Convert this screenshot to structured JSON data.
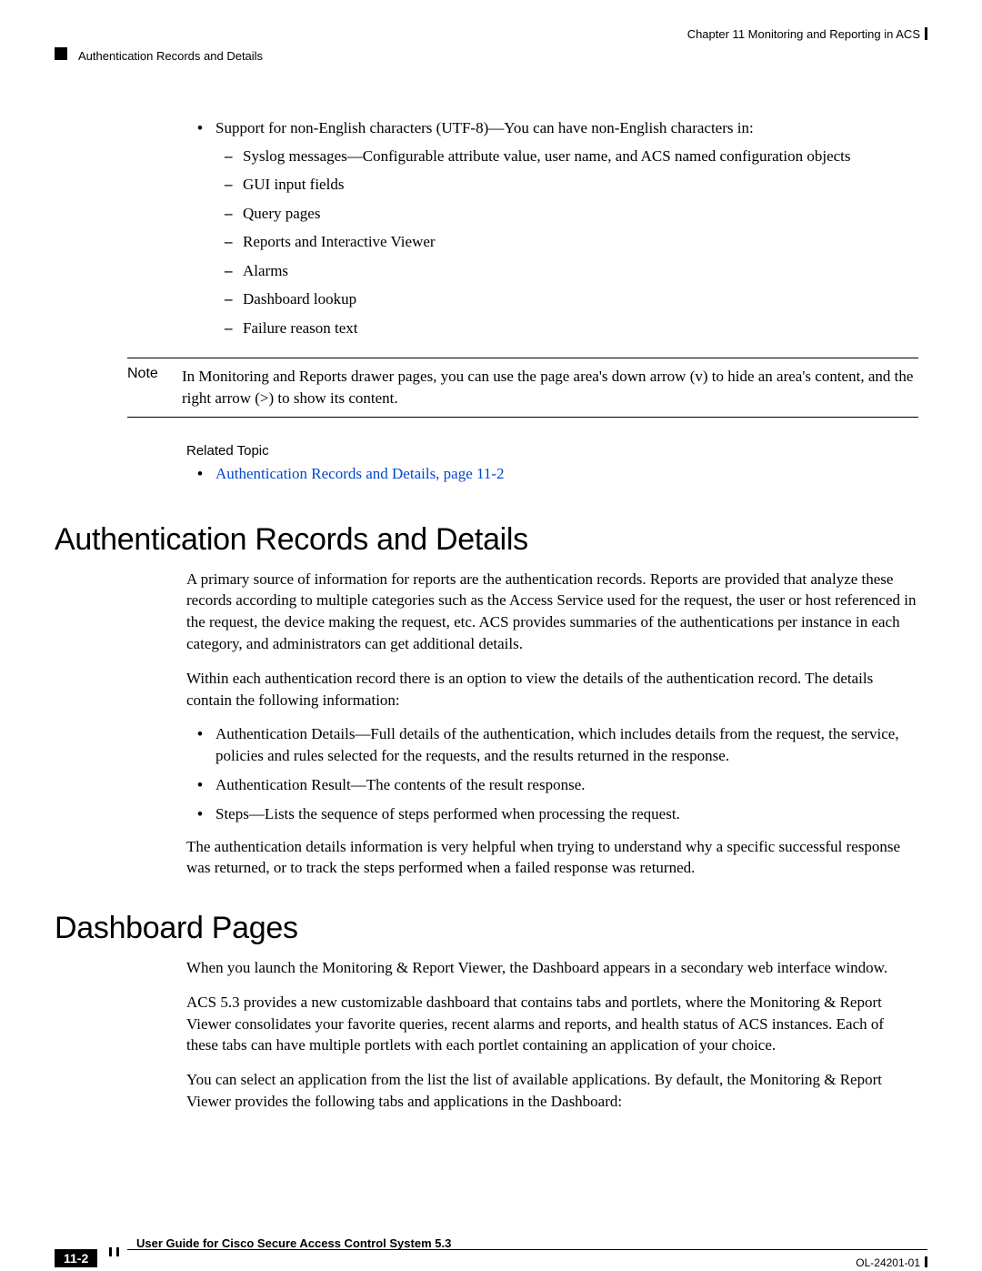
{
  "header": {
    "chapter": "Chapter 11    Monitoring and Reporting in ACS",
    "section": "Authentication Records and Details"
  },
  "bullets": {
    "utf8_intro": "Support for non-English characters (UTF-8)—You can have non-English characters in:",
    "sub1": "Syslog messages—Configurable attribute value, user name, and ACS named configuration objects",
    "sub2": "GUI input fields",
    "sub3": "Query pages",
    "sub4": "Reports and Interactive Viewer",
    "sub5": "Alarms",
    "sub6": "Dashboard lookup",
    "sub7": "Failure reason text"
  },
  "note": {
    "label": "Note",
    "text": "In Monitoring and Reports drawer pages, you can use the page area's down arrow (v) to hide an area's content, and the right arrow (>) to show its content."
  },
  "related": {
    "heading": "Related Topic",
    "link": "Authentication Records and Details, page 11-2"
  },
  "auth": {
    "heading": "Authentication Records and Details",
    "p1": "A primary source of information for reports are the authentication records. Reports are provided that analyze these records according to multiple categories such as the Access Service used for the request, the user or host referenced in the request, the device making the request, etc. ACS provides summaries of the authentications per instance in each category, and administrators can get additional details.",
    "p2": "Within each authentication record there is an option to view the details of the authentication record. The details contain the following information:",
    "b1": "Authentication Details—Full details of the authentication, which includes details from the request, the service, policies and rules selected for the requests, and the results returned in the response.",
    "b2": "Authentication Result—The contents of the result response.",
    "b3": "Steps—Lists the sequence of steps performed when processing the request.",
    "p3": "The authentication details information is very helpful when trying to understand why a specific successful response was returned, or to track the steps performed when a failed response was returned."
  },
  "dashboard": {
    "heading": "Dashboard Pages",
    "p1": "When you launch the Monitoring & Report Viewer, the Dashboard appears in a secondary web interface window.",
    "p2": "ACS 5.3 provides a new customizable dashboard that contains tabs and portlets, where the Monitoring & Report Viewer consolidates your favorite queries, recent alarms and reports, and health status of ACS instances. Each of these tabs can have multiple portlets with each portlet containing an application of your choice.",
    "p3": "You can select an application from the list the list of available applications. By default, the Monitoring & Report Viewer provides the following tabs and applications in the Dashboard:"
  },
  "footer": {
    "title": "User Guide for Cisco Secure Access Control System 5.3",
    "page": "11-2",
    "doc": "OL-24201-01"
  }
}
